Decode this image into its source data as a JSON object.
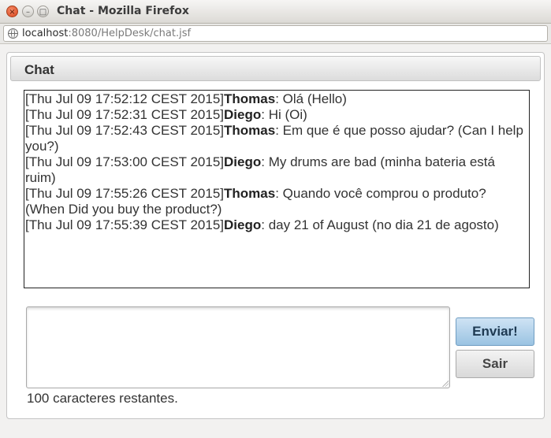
{
  "window": {
    "title": "Chat - Mozilla Firefox",
    "close_glyph": "×",
    "min_glyph": "–",
    "max_glyph": "□"
  },
  "browser": {
    "url_host": "localhost",
    "url_rest": ":8080/HelpDesk/chat.jsf"
  },
  "panel": {
    "title": "Chat"
  },
  "messages": [
    {
      "timestamp": "[Thu Jul 09 17:52:12 CEST 2015]",
      "sender": "Thomas",
      "text": ": Olá (Hello)"
    },
    {
      "timestamp": "[Thu Jul 09 17:52:31 CEST 2015]",
      "sender": "Diego",
      "text": ": Hi (Oi)"
    },
    {
      "timestamp": "[Thu Jul 09 17:52:43 CEST 2015]",
      "sender": "Thomas",
      "text": ": Em que é que posso ajudar? (Can I help you?)"
    },
    {
      "timestamp": "[Thu Jul 09 17:53:00 CEST 2015]",
      "sender": "Diego",
      "text": ": My drums are bad (minha bateria está ruim)"
    },
    {
      "timestamp": "[Thu Jul 09 17:55:26 CEST 2015]",
      "sender": "Thomas",
      "text": ": Quando você comprou o produto? (When Did you buy the product?)"
    },
    {
      "timestamp": "[Thu Jul 09 17:55:39 CEST 2015]",
      "sender": "Diego",
      "text": ": day 21 of August (no dia 21 de agosto)"
    }
  ],
  "input": {
    "value": "",
    "counter_text": "100 caracteres restantes."
  },
  "buttons": {
    "send": "Enviar!",
    "exit": "Sair"
  },
  "colors": {
    "send_button": "#9ac3e2",
    "close_button": "#d9451b"
  }
}
